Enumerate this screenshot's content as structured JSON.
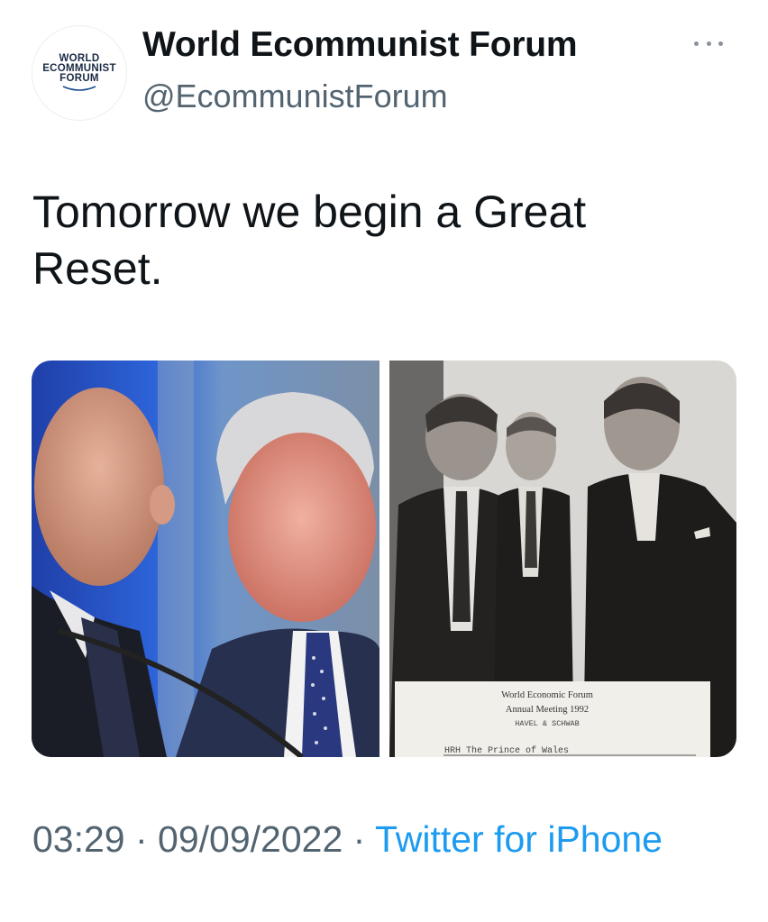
{
  "author": {
    "display_name": "World Ecommunist Forum",
    "handle": "@EcommunistForum",
    "avatar_logo": [
      "WORLD",
      "ECOMMUNIST",
      "FORUM"
    ]
  },
  "tweet": {
    "text": "Tomorrow we begin a Great Reset."
  },
  "media": {
    "right_placard_lines": [
      "World Economic Forum",
      "Annual Meeting 1992",
      "HAVEL & SCHWAB",
      "HRH The Prince of Wales"
    ]
  },
  "meta": {
    "time": "03:29",
    "separator": " · ",
    "date": "09/09/2022",
    "source": "Twitter for iPhone"
  },
  "icons": {
    "more": "more-horizontal-icon"
  },
  "colors": {
    "text": "#0f1419",
    "secondary": "#536471",
    "link": "#1d9bf0"
  }
}
